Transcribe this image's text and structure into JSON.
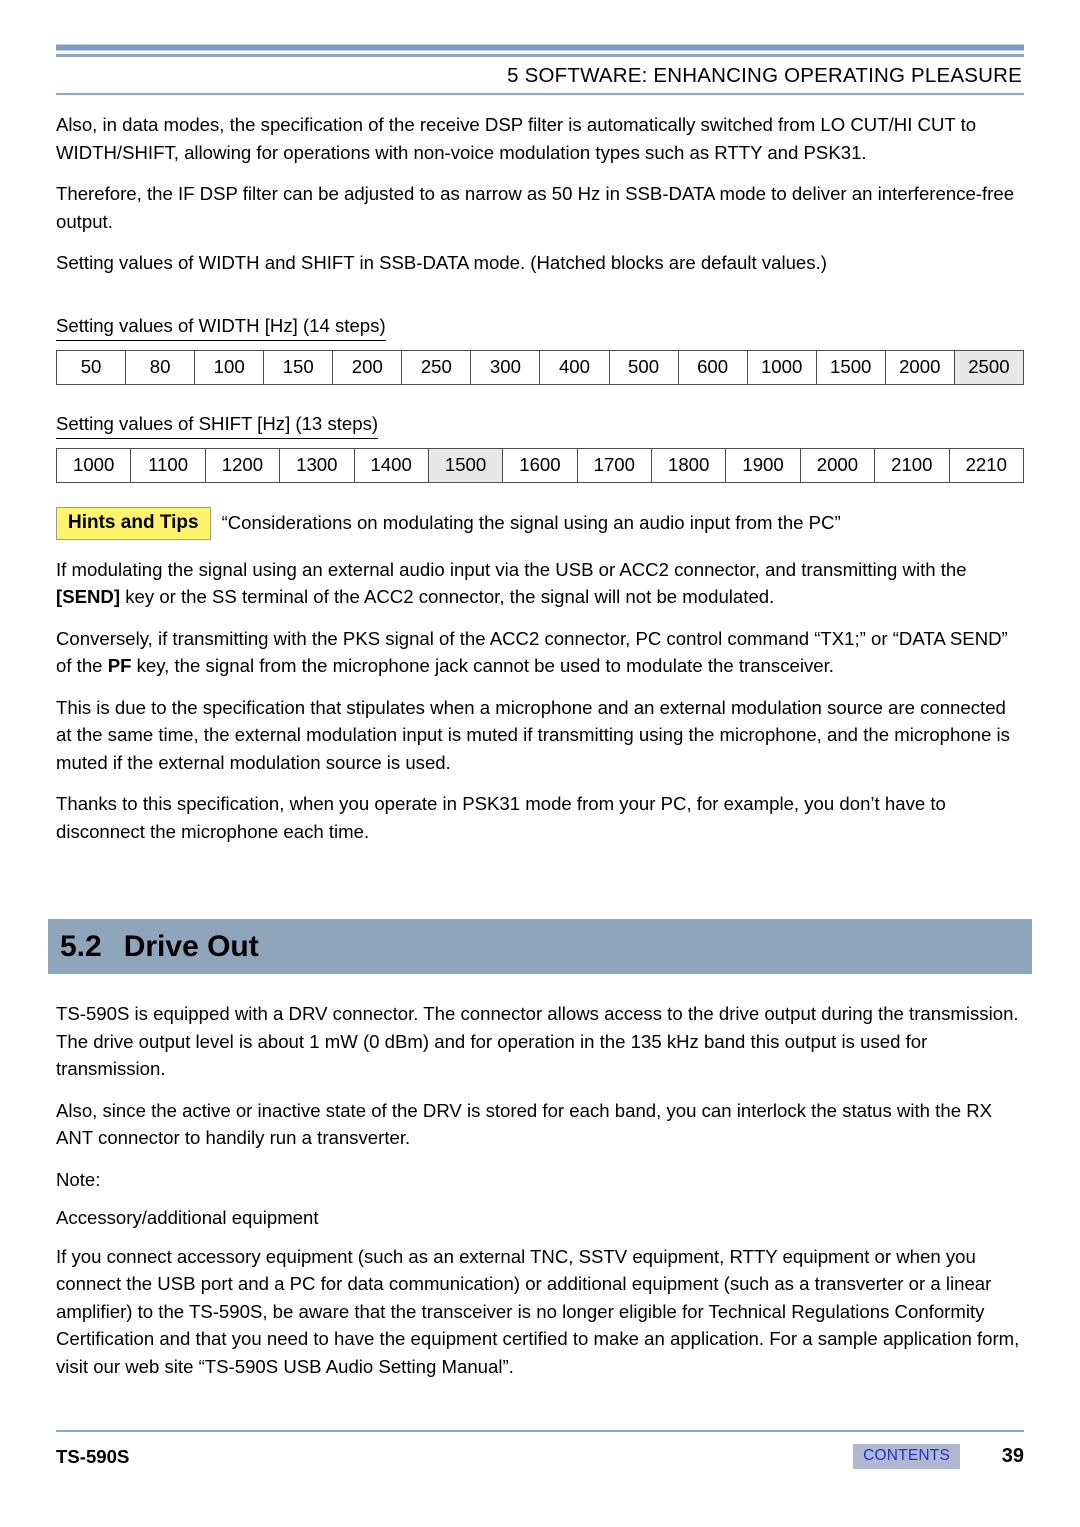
{
  "header": {
    "title": "5 SOFTWARE: ENHANCING OPERATING PLEASURE"
  },
  "intro": {
    "p1": "Also, in data modes, the specification of the receive DSP filter is automatically switched from LO CUT/HI CUT to WIDTH/SHIFT, allowing for operations with non-voice modulation types such as RTTY and PSK31.",
    "p2": "Therefore, the IF DSP filter can be adjusted to as narrow as 50 Hz in SSB-DATA mode to deliver an interference-free output.",
    "p3": "Setting values of WIDTH and SHIFT in SSB-DATA mode.  (Hatched blocks are default values.)"
  },
  "width_table": {
    "heading": "Setting values of WIDTH [Hz] (14 steps)",
    "values": [
      "50",
      "80",
      "100",
      "150",
      "200",
      "250",
      "300",
      "400",
      "500",
      "600",
      "1000",
      "1500",
      "2000",
      "2500"
    ],
    "highlighted_index": 13,
    "highlight_color": "#e8e8e8"
  },
  "shift_table": {
    "heading": "Setting values of SHIFT [Hz] (13 steps)",
    "values": [
      "1000",
      "1100",
      "1200",
      "1300",
      "1400",
      "1500",
      "1600",
      "1700",
      "1800",
      "1900",
      "2000",
      "2100",
      "2210"
    ],
    "highlighted_index": 5,
    "highlight_color": "#e8e8e8"
  },
  "hints": {
    "badge": "Hints and Tips",
    "title": "“Considerations on modulating the signal using an audio input from the PC”",
    "badge_color": "#fff46a",
    "p1_a": "If modulating the signal using an external audio input via the USB or ACC2 connector, and transmitting with the ",
    "p1_b": "[SEND]",
    "p1_c": " key or the SS terminal of the ACC2 connector, the signal will not be modulated.",
    "p2_a": "Conversely, if transmitting with the PKS signal of the ACC2 connector, PC control command “TX1;” or “DATA SEND” of the ",
    "p2_b": "PF",
    "p2_c": " key, the signal from the microphone jack cannot be used to modulate the transceiver.",
    "p3": "This is due to the specification that stipulates when a microphone and an external modulation source are connected at the same time, the external modulation input is muted if transmitting using the microphone, and the microphone is muted if the external modulation source is used.",
    "p4": "Thanks to this specification, when you operate in PSK31 mode from your PC, for example, you don’t have to disconnect the microphone each time."
  },
  "section": {
    "number": "5.2",
    "title": "Drive Out",
    "bar_color": "#8fa5bc",
    "p1": "TS-590S is equipped with a DRV connector.  The connector allows access to the drive output during the transmission.  The drive output level is about 1 mW (0 dBm) and for operation in the 135 kHz band this output is used for transmission.",
    "p2": "Also, since the active or inactive state of the DRV is stored for each band, you can interlock the status with the RX ANT connector to handily run a transverter.",
    "note_label": "Note:",
    "note_sub": "Accessory/additional equipment",
    "note_body": "If you connect accessory equipment (such as an external TNC, SSTV equipment, RTTY equipment or when you connect the USB port and a PC for data communication) or additional equipment (such as a transverter or a linear amplifier) to the TS-590S, be aware that the transceiver is no longer eligible for Technical Regulations Conformity Certification and that you need to have the equipment certified to make an application.  For a sample application form, visit our web site “TS-590S USB Audio Setting Manual”."
  },
  "footer": {
    "model": "TS-590S",
    "contents_link": "CONTENTS",
    "page_number": "39",
    "contents_bg": "#aeb8d0",
    "contents_fg": "#2b2bd6"
  }
}
